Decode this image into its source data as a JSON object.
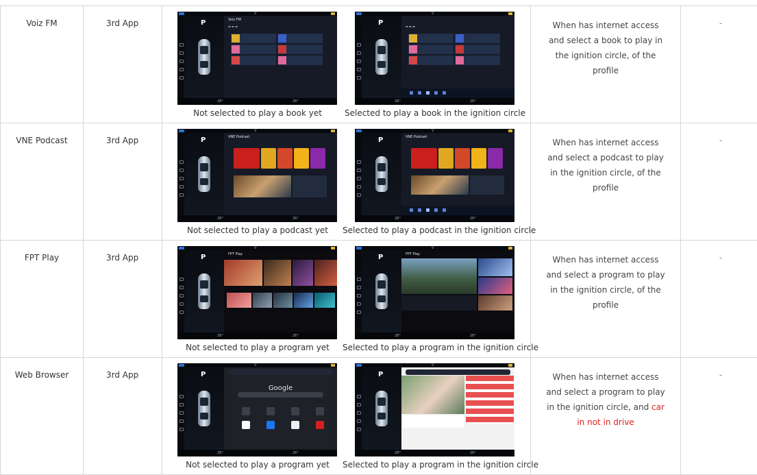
{
  "rows": [
    {
      "app": "Voiz FM",
      "type": "3rd App",
      "caption_left": "Not selected to play a book yet",
      "caption_right": "Selected to play a book in the ignition circle",
      "condition": "When has internet access and select a book to play in the ignition circle, of the profile",
      "note": "-",
      "screen_title": "Voiz FM"
    },
    {
      "app": "VNE Podcast",
      "type": "3rd App",
      "caption_left": "Not selected to play a podcast yet",
      "caption_right": "Selected to play a podcast in the ignition circle",
      "condition": "When has internet access and select a podcast to play in the ignition circle, of the profile",
      "note": "-",
      "screen_title": "VNE Podcast"
    },
    {
      "app": "FPT Play",
      "type": "3rd App",
      "caption_left": "Not selected to play a program yet",
      "caption_right": "Selected to play a program in the ignition circle",
      "condition": "When has internet access and select a program to play in the ignition circle, of the profile",
      "note": "-",
      "screen_title": "FPT Play"
    },
    {
      "app": "Web Browser",
      "type": "3rd App",
      "caption_left": "Not selected to play a program yet",
      "caption_right": "Selected to play a program in the ignition circle",
      "condition_plain": "When has internet access and select a program to play in the ignition circle, and ",
      "condition_red": "car in not in drive",
      "note": "-",
      "screen_title": "Google"
    }
  ],
  "screen": {
    "profile_letter": "P",
    "temp_left": "28°",
    "temp_right": "26°"
  },
  "colors": {
    "border": "#d6d6d6",
    "text": "#333333",
    "warning_red": "#e02020",
    "screen_bg": "#0d1117"
  }
}
